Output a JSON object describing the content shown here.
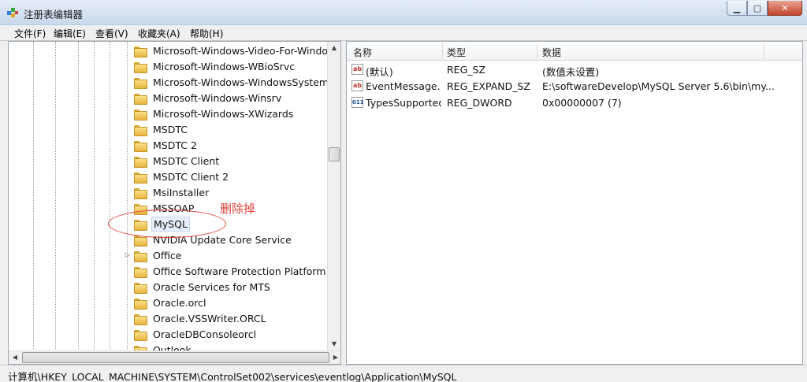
{
  "window": {
    "title": "注册表编辑器",
    "buttons": {
      "minimize": "▁",
      "maximize": "▢",
      "close": "✕"
    }
  },
  "menu": [
    "文件(F)",
    "编辑(E)",
    "查看(V)",
    "收藏夹(A)",
    "帮助(H)"
  ],
  "tree": {
    "items": [
      {
        "label": "Microsoft-Windows-Video-For-Windows",
        "expander": ""
      },
      {
        "label": "Microsoft-Windows-WBioSrvc",
        "expander": ""
      },
      {
        "label": "Microsoft-Windows-WindowsSystemAssessmentTool",
        "expander": ""
      },
      {
        "label": "Microsoft-Windows-Winsrv",
        "expander": ""
      },
      {
        "label": "Microsoft-Windows-XWizards",
        "expander": ""
      },
      {
        "label": "MSDTC",
        "expander": ""
      },
      {
        "label": "MSDTC 2",
        "expander": ""
      },
      {
        "label": "MSDTC Client",
        "expander": ""
      },
      {
        "label": "MSDTC Client 2",
        "expander": ""
      },
      {
        "label": "MsiInstaller",
        "expander": ""
      },
      {
        "label": "MSSOAP",
        "expander": ""
      },
      {
        "label": "MySQL",
        "expander": "",
        "selected": true
      },
      {
        "label": "NVIDIA Update Core Service",
        "expander": ""
      },
      {
        "label": "Office",
        "expander": "▷"
      },
      {
        "label": "Office Software Protection Platform Service",
        "expander": ""
      },
      {
        "label": "Oracle Services for MTS",
        "expander": ""
      },
      {
        "label": "Oracle.orcl",
        "expander": ""
      },
      {
        "label": "Oracle.VSSWriter.ORCL",
        "expander": ""
      },
      {
        "label": "OracleDBConsoleorcl",
        "expander": ""
      },
      {
        "label": "Outlook",
        "expander": ""
      }
    ]
  },
  "list": {
    "columns": {
      "name": "名称",
      "type": "类型",
      "data": "数据"
    },
    "rows": [
      {
        "icon": "string-value-icon",
        "icon_glyph": "ab",
        "name": "(默认)",
        "type": "REG_SZ",
        "data": "(数值未设置)"
      },
      {
        "icon": "string-value-icon",
        "icon_glyph": "ab",
        "name": "EventMessage...",
        "type": "REG_EXPAND_SZ",
        "data": "E:\\softwareDevelop\\MySQL Server 5.6\\bin\\my..."
      },
      {
        "icon": "binary-value-icon",
        "icon_glyph": "011",
        "name": "TypesSupported",
        "type": "REG_DWORD",
        "data": "0x00000007 (7)"
      }
    ]
  },
  "status": {
    "path": "计算机\\HKEY_LOCAL_MACHINE\\SYSTEM\\ControlSet002\\services\\eventlog\\Application\\MySQL"
  },
  "annotation": {
    "text": "删除掉",
    "color": "#e0413a"
  }
}
